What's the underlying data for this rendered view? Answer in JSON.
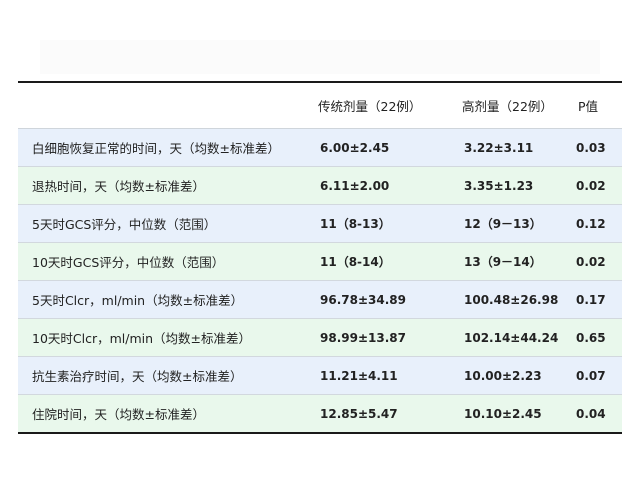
{
  "table": {
    "headers": [
      "",
      "传统剂量（22例）",
      "高剂量（22例）",
      "P值"
    ],
    "rows": [
      {
        "label": "白细胞恢复正常的时间，天（均数±标准差）",
        "conventional": "6.00±2.45",
        "high": "3.22±3.11",
        "p": "0.03",
        "color": "#e8f0fb"
      },
      {
        "label": "退热时间，天（均数±标准差）",
        "conventional": "6.11±2.00",
        "high": "3.35±1.23",
        "p": "0.02",
        "color": "#e9f8ec"
      },
      {
        "label": "5天时GCS评分，中位数（范围）",
        "conventional": "11（8-13）",
        "high": "12（9－13）",
        "p": "0.12",
        "color": "#e8f0fb"
      },
      {
        "label": "10天时GCS评分，中位数（范围）",
        "conventional": "11（8-14）",
        "high": "13（9－14）",
        "p": "0.02",
        "color": "#e9f8ec"
      },
      {
        "label": "5天时Clcr，ml/min（均数±标准差）",
        "conventional": "96.78±34.89",
        "high": "100.48±26.98",
        "p": "0.17",
        "color": "#e8f0fb"
      },
      {
        "label": "10天时Clcr，ml/min（均数±标准差）",
        "conventional": "98.99±13.87",
        "high": "102.14±44.24",
        "p": "0.65",
        "color": "#e9f8ec"
      },
      {
        "label": "抗生素治疗时间，天（均数±标准差）",
        "conventional": "11.21±4.11",
        "high": "10.00±2.23",
        "p": "0.07",
        "color": "#e8f0fb"
      },
      {
        "label": "住院时间，天（均数±标准差）",
        "conventional": "12.85±5.47",
        "high": "10.10±2.45",
        "p": "0.04",
        "color": "#e9f8ec"
      }
    ]
  }
}
